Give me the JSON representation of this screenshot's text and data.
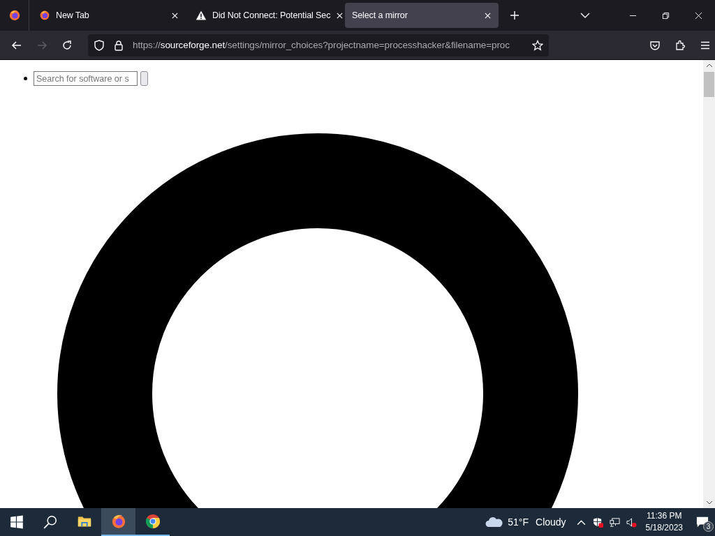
{
  "tabs": [
    {
      "title": "New Tab",
      "kind": "firefox",
      "selected": false
    },
    {
      "title": "Did Not Connect: Potential Sec",
      "kind": "warning",
      "selected": false
    },
    {
      "title": "Select a mirror",
      "kind": "plain",
      "selected": true
    }
  ],
  "navigation": {
    "forward_disabled": true
  },
  "address_bar": {
    "scheme": "https://",
    "domain": "sourceforge.net",
    "path": "/settings/mirror_choices?projectname=processhacker&filename=proc"
  },
  "page": {
    "search": {
      "placeholder": "Search for software or s"
    }
  },
  "taskbar": {
    "apps": [
      {
        "kind": "explorer",
        "selected": false,
        "running": false
      },
      {
        "kind": "firefox",
        "selected": true,
        "running": true
      },
      {
        "kind": "chrome",
        "selected": false,
        "running": true
      }
    ],
    "weather": {
      "temperature": "51°F",
      "condition": "Cloudy"
    },
    "clock": {
      "time": "11:36 PM",
      "date": "5/18/2023"
    },
    "notifications": "3"
  }
}
